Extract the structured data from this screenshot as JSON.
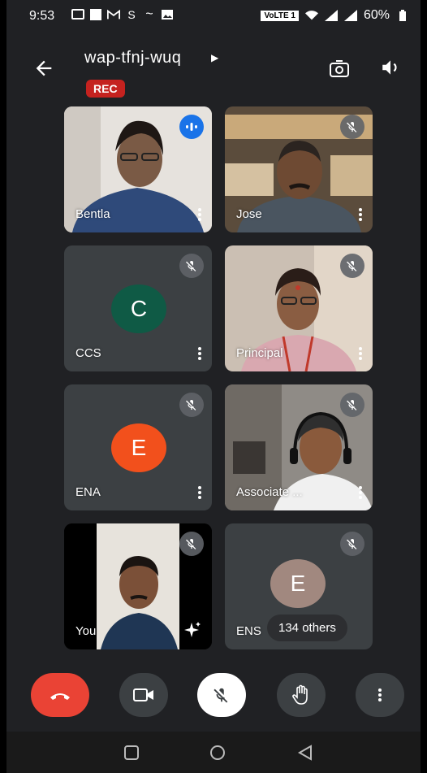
{
  "status": {
    "time": "9:53",
    "network": "VoLTE 1",
    "battery": "60%"
  },
  "meeting": {
    "code": "wap-tfnj-wuq",
    "rec_label": "REC"
  },
  "participants": [
    {
      "name": "Bentla"
    },
    {
      "name": "Jose"
    },
    {
      "name": "CCS",
      "initial": "C"
    },
    {
      "name": "Principal"
    },
    {
      "name": "ENA",
      "initial": "E"
    },
    {
      "name": "Associate ..."
    },
    {
      "name": "You"
    },
    {
      "name": "ENS",
      "initial": "E"
    }
  ],
  "others_label": "134 others",
  "colors": {
    "avatar_ccs": "#0f5a45",
    "avatar_ena": "#f2501c",
    "avatar_ens": "#a1887f",
    "end_call": "#ea4335",
    "rec": "#c5221f"
  },
  "icons": [
    "back-arrow-icon",
    "camera-switch-icon",
    "speaker-icon",
    "mic-off-icon",
    "speaking-icon",
    "more-vert-icon",
    "sparkle-effects-icon",
    "end-call-icon",
    "video-icon",
    "hand-raise-icon",
    "recents-icon",
    "home-icon",
    "back-nav-icon"
  ]
}
